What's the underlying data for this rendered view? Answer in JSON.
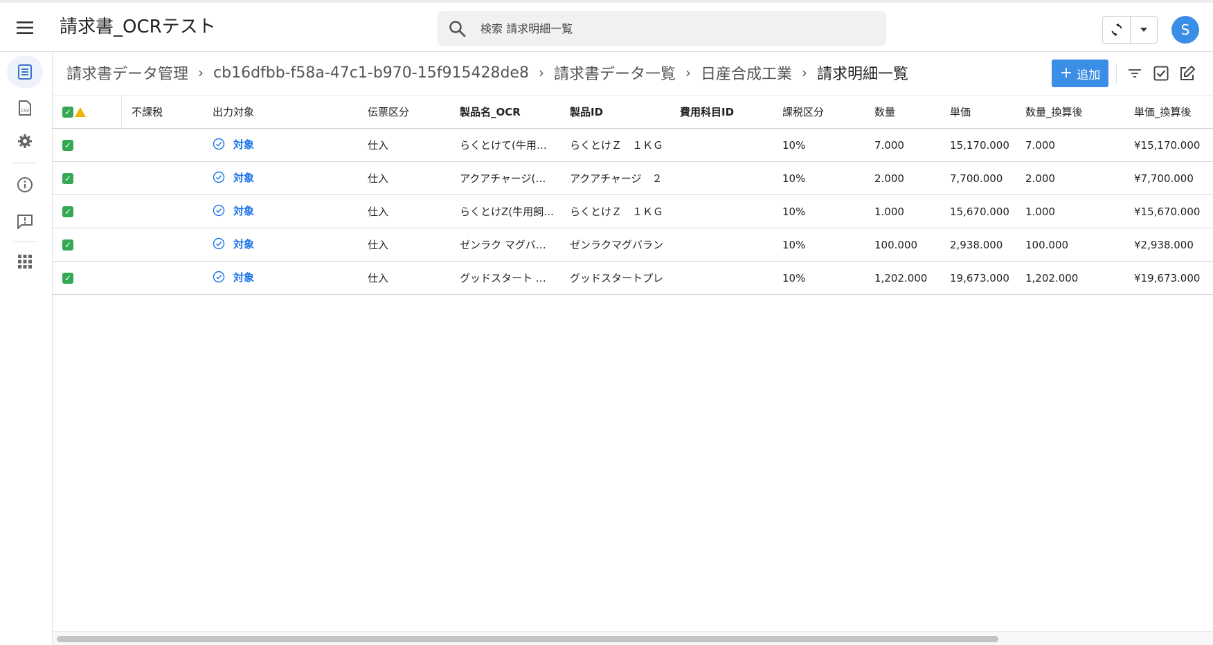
{
  "header": {
    "app_title": "請求書_OCRテスト",
    "search_placeholder": "検索 請求明細一覧",
    "avatar_initial": "S",
    "accent_color": "#3a8ee6"
  },
  "sidebar": {
    "items": [
      {
        "icon": "document-list-icon",
        "active": true
      },
      {
        "icon": "csv-file-icon",
        "active": false
      },
      {
        "icon": "gear-icon",
        "active": false
      },
      {
        "icon": "info-icon",
        "active": false
      },
      {
        "icon": "feedback-icon",
        "active": false
      },
      {
        "icon": "apps-grid-icon",
        "active": false
      }
    ]
  },
  "breadcrumb": {
    "items": [
      "請求書データ管理",
      "cb16dfbb-f58a-47c1-b970-15f915428de8",
      "請求書データ一覧",
      "日産合成工業"
    ],
    "current": "請求明細一覧",
    "separator": "›"
  },
  "toolbar": {
    "add_label": "追加",
    "add_plus": "+"
  },
  "table": {
    "columns": [
      "",
      "不課税",
      "出力対象",
      "伝票区分",
      "製品名_OCR",
      "製品ID",
      "費用科目ID",
      "課税区分",
      "数量",
      "単価",
      "数量_換算後",
      "単価_換算後"
    ],
    "rows": [
      {
        "status": "✓",
        "non_taxable": "",
        "output": "対象",
        "slip": "仕入",
        "name_ocr": "らくとけて(牛用…",
        "product_id": "らくとけＺ　１ＫＧ",
        "expense_id": "",
        "tax": "10%",
        "qty": "7.000",
        "price": "15,170.000",
        "qty_conv": "7.000",
        "price_conv": "¥15,170.000"
      },
      {
        "status": "✓",
        "non_taxable": "",
        "output": "対象",
        "slip": "仕入",
        "name_ocr": "アクアチャージ(…",
        "product_id": "アクアチャージ　２",
        "expense_id": "",
        "tax": "10%",
        "qty": "2.000",
        "price": "7,700.000",
        "qty_conv": "2.000",
        "price_conv": "¥7,700.000"
      },
      {
        "status": "✓",
        "non_taxable": "",
        "output": "対象",
        "slip": "仕入",
        "name_ocr": "らくとけZ(牛用飼…",
        "product_id": "らくとけＺ　１ＫＧ",
        "expense_id": "",
        "tax": "10%",
        "qty": "1.000",
        "price": "15,670.000",
        "qty_conv": "1.000",
        "price_conv": "¥15,670.000"
      },
      {
        "status": "✓",
        "non_taxable": "",
        "output": "対象",
        "slip": "仕入",
        "name_ocr": "ゼンラク マグバ…",
        "product_id": "ゼンラクマグバラン",
        "expense_id": "",
        "tax": "10%",
        "qty": "100.000",
        "price": "2,938.000",
        "qty_conv": "100.000",
        "price_conv": "¥2,938.000"
      },
      {
        "status": "✓",
        "non_taxable": "",
        "output": "対象",
        "slip": "仕入",
        "name_ocr": "グッドスタート …",
        "product_id": "グッドスタートプレ",
        "expense_id": "",
        "tax": "10%",
        "qty": "1,202.000",
        "price": "19,673.000",
        "qty_conv": "1,202.000",
        "price_conv": "¥19,673.000"
      }
    ]
  }
}
